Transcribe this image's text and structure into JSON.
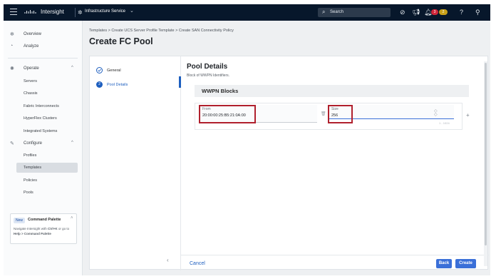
{
  "app": {
    "title": "Intersight",
    "service": "Infrastructure Service"
  },
  "search": {
    "label": "Search"
  },
  "topbar": {
    "badge_red": "3",
    "badge_yellow": "2"
  },
  "sidebar": {
    "items": [
      {
        "label": "Overview"
      },
      {
        "label": "Analyze"
      },
      {
        "label": "Operate"
      },
      {
        "label": "Servers"
      },
      {
        "label": "Chassis"
      },
      {
        "label": "Fabric Interconnects"
      },
      {
        "label": "HyperFlex Clusters"
      },
      {
        "label": "Integrated Systems"
      },
      {
        "label": "Configure"
      },
      {
        "label": "Profiles"
      },
      {
        "label": "Templates"
      },
      {
        "label": "Policies"
      },
      {
        "label": "Pools"
      }
    ],
    "palette": {
      "badge": "New",
      "title": "Command Palette",
      "desc_1": "Navigate Intersight with ",
      "desc_key": "Ctrl+K",
      "desc_2": " or go to ",
      "desc_3": "Help > Command Palette"
    }
  },
  "header": {
    "breadcrumb": "Templates  >  Create UCS Server Profile Template  >  Create SAN Connectivity Policy",
    "title": "Create FC Pool"
  },
  "steps": [
    {
      "label": "General"
    },
    {
      "label": "Pool Details",
      "number": "2"
    }
  ],
  "details": {
    "title": "Pool Details",
    "description": "Block of WWPN Identifiers.",
    "blocks_title": "WWPN Blocks",
    "from_label": "From",
    "from_value": "20:00:00:25:B5:21:0A:00",
    "size_label": "Size",
    "size_value": "256",
    "size_range": "1 - 1024"
  },
  "footer": {
    "cancel": "Cancel",
    "back": "Back",
    "create": "Create"
  },
  "colors": {
    "topbar": "#07172b",
    "accent": "#3a6fd8",
    "highlight": "#b0202d"
  }
}
